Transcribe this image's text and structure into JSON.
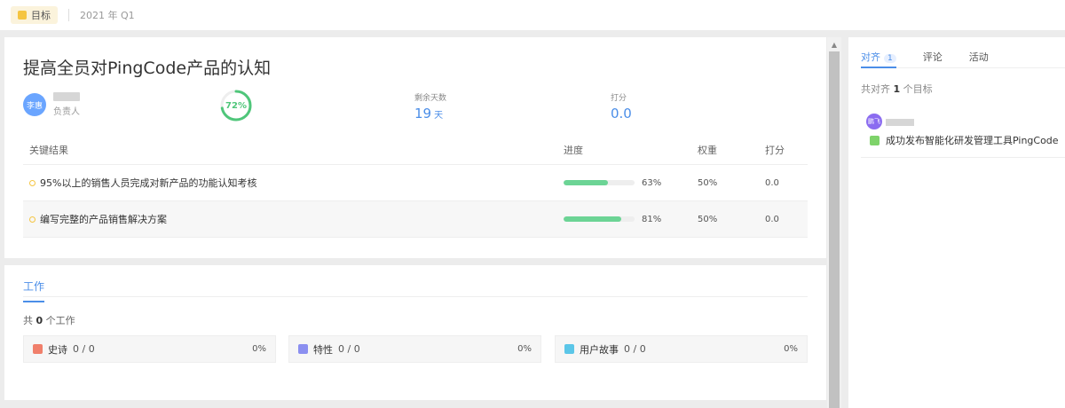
{
  "topbar": {
    "tag_label": "目标",
    "period": "2021 年 Q1"
  },
  "objective": {
    "title": "提高全员对PingCode产品的认知",
    "owner": {
      "avatar_text": "李惠",
      "role_label": "负责人"
    },
    "progress_label": "72%",
    "progress_value": 72,
    "remaining": {
      "label": "剩余天数",
      "value": "19",
      "unit": "天"
    },
    "score": {
      "label": "打分",
      "value": "0.0"
    }
  },
  "key_results": {
    "headers": {
      "name": "关键结果",
      "progress": "进度",
      "weight": "权重",
      "score": "打分"
    },
    "rows": [
      {
        "name": "95%以上的销售人员完成对新产品的功能认知考核",
        "progress": 63,
        "progress_label": "63%",
        "weight": "50%",
        "score": "0.0"
      },
      {
        "name": "编写完整的产品销售解决方案",
        "progress": 81,
        "progress_label": "81%",
        "weight": "50%",
        "score": "0.0"
      }
    ]
  },
  "work": {
    "tab_label": "工作",
    "total_prefix": "共",
    "total_count": "0",
    "total_suffix": "个工作",
    "items": [
      {
        "label": "史诗",
        "count": "0 / 0",
        "percent": "0%",
        "icon": "epic-icon",
        "color": "#f07f6b"
      },
      {
        "label": "特性",
        "count": "0 / 0",
        "percent": "0%",
        "icon": "feature-icon",
        "color": "#8b8ff0"
      },
      {
        "label": "用户故事",
        "count": "0 / 0",
        "percent": "0%",
        "icon": "story-icon",
        "color": "#5bc6e8"
      }
    ]
  },
  "right_panel": {
    "tabs": [
      {
        "label": "对齐",
        "badge": "1"
      },
      {
        "label": "评论"
      },
      {
        "label": "活动"
      }
    ],
    "total_prefix": "共对齐",
    "total_count": "1",
    "total_suffix": "个目标",
    "aligned": {
      "avatar_text": "鹏飞",
      "goal": "成功发布智能化研发管理工具PingCode"
    }
  },
  "colors": {
    "accent": "#4b8ee8",
    "progress": "#6cd495",
    "ring": "#4fc67a"
  }
}
